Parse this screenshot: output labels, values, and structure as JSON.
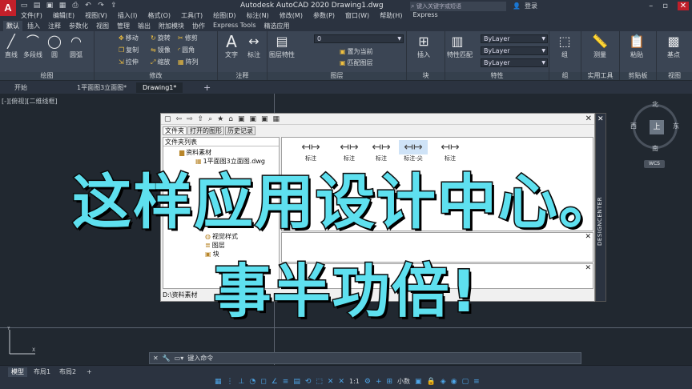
{
  "app": {
    "logo": "A",
    "window_title": "Autodesk AutoCAD 2020    Drawing1.dwg",
    "search_placeholder": "键入关键字或短语",
    "login_label": "登录"
  },
  "quick_access": [
    "new-icon",
    "open-icon",
    "save-icon",
    "saveas-icon",
    "print-icon",
    "undo-icon",
    "redo-icon",
    "share-icon"
  ],
  "menubar": [
    "文件(F)",
    "编辑(E)",
    "视图(V)",
    "插入(I)",
    "格式(O)",
    "工具(T)",
    "绘图(D)",
    "标注(N)",
    "修改(M)",
    "参数(P)",
    "窗口(W)",
    "帮助(H)",
    "Express"
  ],
  "ribbon_tabs": [
    "默认",
    "插入",
    "注释",
    "参数化",
    "视图",
    "管理",
    "输出",
    "附加模块",
    "协作",
    "Express Tools",
    "精选应用"
  ],
  "ribbon": {
    "draw": {
      "title": "绘图",
      "tools": [
        "直线",
        "多段线",
        "圆",
        "圆弧"
      ]
    },
    "modify": {
      "title": "修改",
      "tools": [
        "移动",
        "旋转",
        "修剪",
        "复制",
        "镜像",
        "圆角",
        "拉伸",
        "缩放",
        "阵列"
      ]
    },
    "annotation": {
      "title": "注释",
      "tools": [
        "文字",
        "标注"
      ]
    },
    "layers": {
      "title": "图层",
      "tools": [
        "图层特性",
        "置为当前",
        "匹配图层"
      ],
      "current_layer": "0"
    },
    "block": {
      "title": "块",
      "tools": [
        "插入"
      ]
    },
    "properties": {
      "title": "特性",
      "tools": [
        "特性匹配"
      ],
      "color": "ByLayer",
      "linetype": "ByLayer",
      "lineweight": "ByLayer"
    },
    "groups": {
      "title": "组",
      "tools": [
        "组"
      ]
    },
    "utilities": {
      "title": "实用工具",
      "tools": [
        "测量"
      ]
    },
    "clipboard": {
      "title": "剪贴板",
      "tools": [
        "粘贴"
      ]
    },
    "view": {
      "title": "视图",
      "tools": [
        "基点"
      ]
    }
  },
  "file_tabs": [
    "开始",
    "1平面图3立面图*",
    "Drawing1*"
  ],
  "viewport_label": "[-][俯视][二维线框]",
  "viewcube": {
    "face": "上",
    "north": "北",
    "south": "南",
    "east": "东",
    "west": "西",
    "wcs": "WCS"
  },
  "design_center": {
    "tabs": [
      "文件夹",
      "打开的图形",
      "历史记录"
    ],
    "tree_header": "文件夹列表",
    "tree_items": [
      "资料素材",
      "1平面图3立面图.dwg",
      "视觉样式",
      "图层",
      "块"
    ],
    "palette_items": [
      "标注",
      "标注",
      "标注",
      "标注-尖",
      "标注"
    ],
    "status_path": "D:\\资料素材",
    "sidebar_label": "DESIGNCENTER"
  },
  "banner": {
    "line1": "这样应用设计中心。",
    "line2": "事半功倍!"
  },
  "command": {
    "placeholder": "键入命令"
  },
  "layout_tabs": [
    "模型",
    "布局1",
    "布局2"
  ],
  "status_bar": {
    "scale": "1:1",
    "annotation_scale": "小数"
  }
}
